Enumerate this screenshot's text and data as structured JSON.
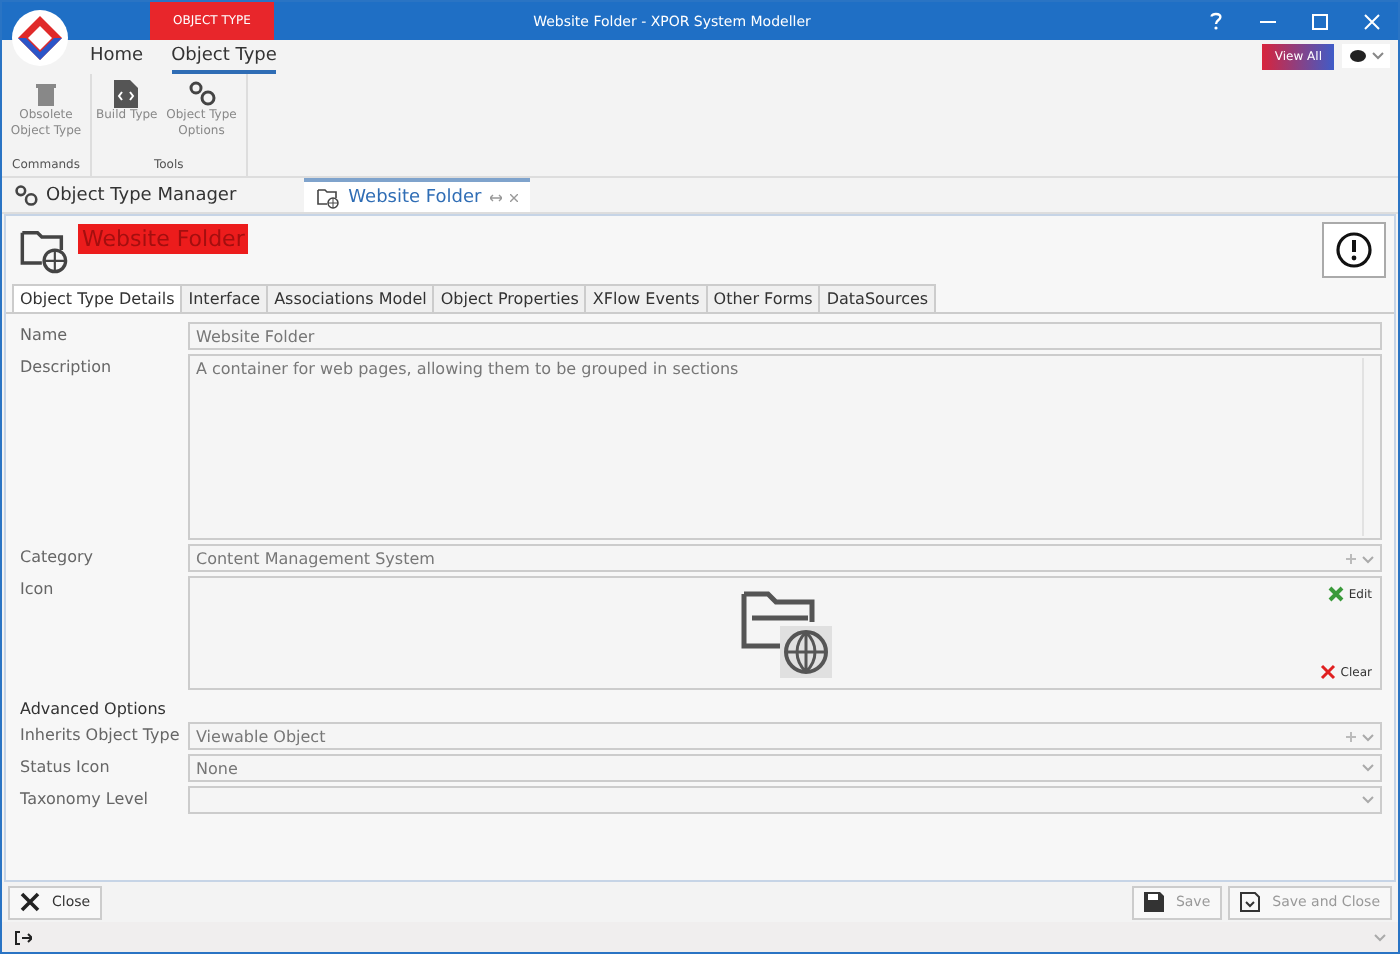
{
  "window": {
    "title": "Website Folder - XPOR System Modeller",
    "context_tab": "OBJECT TYPE"
  },
  "ribbon": {
    "tabs": [
      {
        "label": "Home",
        "selected": false
      },
      {
        "label": "Object Type",
        "selected": true
      }
    ],
    "groups": [
      {
        "label": "Commands",
        "buttons": [
          {
            "label": "Obsolete Object Type"
          }
        ]
      },
      {
        "label": "Tools",
        "buttons": [
          {
            "label": "Build Type"
          },
          {
            "label": "Object Type Options"
          }
        ]
      }
    ],
    "view_all": "View All"
  },
  "documents": [
    {
      "label": "Object Type Manager",
      "selected": false
    },
    {
      "label": "Website Folder",
      "selected": true
    }
  ],
  "header": {
    "title": "Website Folder"
  },
  "tabs": [
    {
      "label": "Object Type Details",
      "selected": true
    },
    {
      "label": "Interface",
      "selected": false
    },
    {
      "label": "Associations Model",
      "selected": false
    },
    {
      "label": "Object Properties",
      "selected": false
    },
    {
      "label": "XFlow Events",
      "selected": false
    },
    {
      "label": "Other Forms",
      "selected": false
    },
    {
      "label": "DataSources",
      "selected": false
    }
  ],
  "fields": [
    {
      "kind": "text",
      "label": "Name",
      "value": "Website Folder"
    },
    {
      "kind": "textarea",
      "label": "Description",
      "value": "A container for web pages, allowing them to be grouped in sections"
    },
    {
      "kind": "combo",
      "label": "Category",
      "value": "Content Management System",
      "add": true
    },
    {
      "kind": "icon",
      "label": "Icon",
      "edit": "Edit",
      "clear": "Clear"
    },
    {
      "kind": "section",
      "label": "Advanced Options"
    },
    {
      "kind": "combo",
      "label": "Inherits Object Type",
      "value": "Viewable Object",
      "add": true
    },
    {
      "kind": "combo",
      "label": "Status Icon",
      "value": "None",
      "add": false
    },
    {
      "kind": "combo",
      "label": "Taxonomy Level",
      "add": false
    }
  ],
  "footer": [
    {
      "label": "Close",
      "disabled": false
    },
    {
      "label": "Save",
      "disabled": true
    },
    {
      "label": "Save and Close",
      "disabled": true
    }
  ]
}
